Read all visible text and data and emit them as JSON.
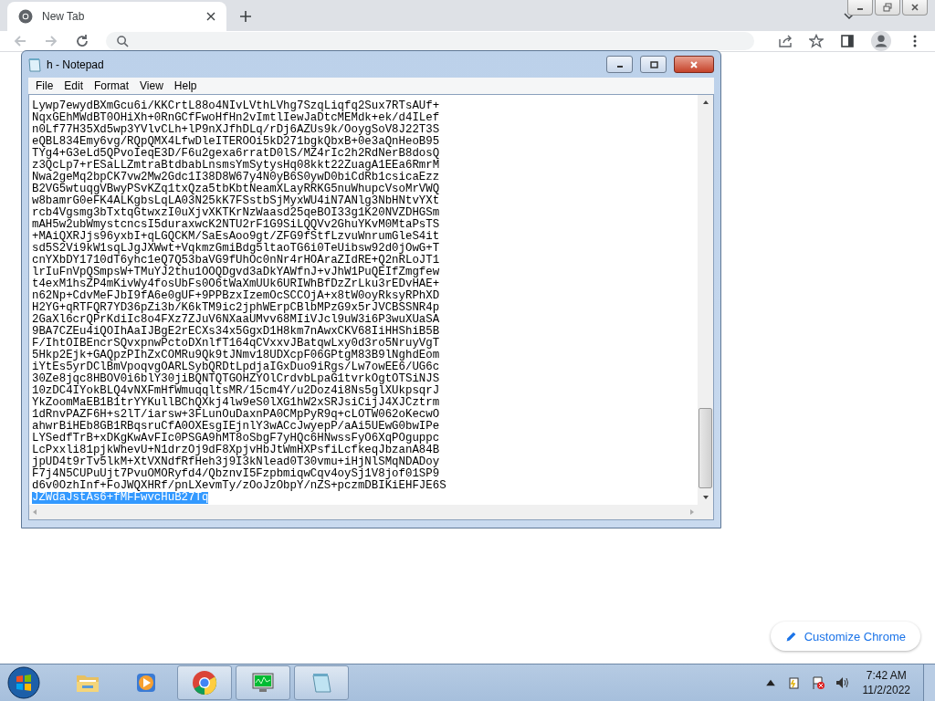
{
  "browser": {
    "tabs": [
      {
        "title": "New Tab",
        "selected": true
      }
    ],
    "customize_button": "Customize Chrome"
  },
  "notepad": {
    "title": "h - Notepad",
    "menu": [
      "File",
      "Edit",
      "Format",
      "View",
      "Help"
    ],
    "lines": [
      {
        "text": "Lywp7ewydBXmGcu6i/KKCrtL88o4NIvLVthLVhg7SzqLiqfq2Sux7RTsAUf+",
        "selected": false
      },
      {
        "text": "NqxGEhMWdBT0OHiXh+0RnGCfFwoHfHn2vImtlIewJaDtcMEMdk+ek/d4ILef",
        "selected": false
      },
      {
        "text": "n0Lf77H35Xd5wp3YVlvCLh+lP9nXJfhDLq/rDj6AZUs9k/OoygSoV8J22T3S",
        "selected": false
      },
      {
        "text": "eQBL834Emy6vg/RQpQMX4LfwDleITEROOi5kD271bgkQbxB+0e3aQnHeoB95",
        "selected": false
      },
      {
        "text": "TYg4+G3eLd5QPvoIeqE3D/F6u2gexa6rratD0lS/MZ4rIc2h2RdNerB8dosQ",
        "selected": false
      },
      {
        "text": "z3QcLp7+rESaLLZmtraBtdbabLnsmsYmSytysHq08kkt22ZuagA1EEa6RmrM",
        "selected": false
      },
      {
        "text": "Nwa2geMq2bpCK7vw2Mw2Gdc1I38D8W67y4N0yB6S0ywD0biCdRb1csicaEzz",
        "selected": false
      },
      {
        "text": "B2VG5wtuqgVBwyPSvKZq1txQza5tbKbtNeamXLayRRKG5nuWhupcVsoMrVWQ",
        "selected": false
      },
      {
        "text": "w8bamrG0eFK4ALKgbsLqLA03N25kK7FSstbSjMyxWU4iN7ANlg3NbHNtvYXt",
        "selected": false
      },
      {
        "text": "rcb4Vgsmg3bTxtqGtwxzI0uXjvXKTKrNzWaasd25qeBOI33g1K20NVZDHGSm",
        "selected": false
      },
      {
        "text": "mAH5w2ubWmystcncsI5duraxwcK2NTU2rF1G9SiLQQVv2GhuYKvM0MtaPsTS",
        "selected": false
      },
      {
        "text": "+MAiQXRJjs96yxbI+qLGQCKM/SaEsAoo9gt/ZFG9fStfLzvuWnrumGleS4it",
        "selected": false
      },
      {
        "text": "sd5S2Vi9kW1sqLJgJXWwt+VqkmzGmiBdg5ltaoTG6i0TeUibsw92d0jOwG+T",
        "selected": false
      },
      {
        "text": "cnYXbDY1710dT6yhc1eQ7Q53baVG9fUhOc0nNr4rHOAraZIdRE+Q2nRLoJT1",
        "selected": false
      },
      {
        "text": "lrIuFnVpQSmpsW+TMuYJ2thu1OOQDgvd3aDkYAWfnJ+vJhW1PuQEIfZmgfew",
        "selected": false
      },
      {
        "text": "t4exM1hsZP4mKivWy4fosUbFs0O6tWaXmUUk6URIWhBfDzZrLku3rEDvHAE+",
        "selected": false
      },
      {
        "text": "n62Np+CdvMeFJbI9fA6e0gUF+9PPBzxIzemOcSCCOjA+x8tW0oyRksyRPhXD",
        "selected": false
      },
      {
        "text": "H2YG+qRTFQR7YD36pZi3b/K6kTM9ic2jphWErpCBlbMPzG9x5rJVCBSSNR4p",
        "selected": false
      },
      {
        "text": "2GaXl6crQPrKdiIc8o4FXz7ZJuV6NXaaUMvv68MIiVJcl9uW3i6P3wuXUaSA",
        "selected": false
      },
      {
        "text": "9BA7CZEu4iQOIhAaIJBgE2rECXs34x5GgxD1H8km7nAwxCKV68IiHHShiB5B",
        "selected": false
      },
      {
        "text": "F/IhtOIBEncrSQvxpnwPctoDXnlfT164qCVxxvJBatqwLxy0d3ro5NruyVgT",
        "selected": false
      },
      {
        "text": "5Hkp2Ejk+GAQpzPIhZxCOMRu9Qk9tJNmv18UDXcpF06GPtgM83B9lNghdEom",
        "selected": false
      },
      {
        "text": "iYtEs5yrDClBmVpoqvgOARLSybQRDtLpdjaIGxDuo9iRgs/Lw7owEE6/UG6c",
        "selected": false
      },
      {
        "text": "30Ze8jqc8HBOV0i6blY30jiBQNTQTGOHZYOlCrdvbLpaG1tvrkOgtOTSiNJS",
        "selected": false
      },
      {
        "text": "10zDC4IYokBLQ4vNXFmHfWmuqqltsMR/15cm4Y/u2Doz4i8Ns5glXUkpsqrJ",
        "selected": false
      },
      {
        "text": "YkZoomMaEB1B1trYYKullBChQXkj4lw9eS0lXG1hW2xSRJsiCijJ4XJCztrm",
        "selected": false
      },
      {
        "text": "1dRnvPAZF6H+s2lT/iarsw+3FLunOuDaxnPA0CMpPyR9q+cLOTW062oKecwO",
        "selected": false
      },
      {
        "text": "ahwrBiHEb8GB1RBqsruCfA0OXEsgIEjnlY3wACcJwyepP/aAi5UEwG0bwIPe",
        "selected": false
      },
      {
        "text": "LYSedfTrB+xDKgKwAvFIc0PSGA9hMT8oSbgF7yHQc6HNwssFyO6XqPOguppc",
        "selected": false
      },
      {
        "text": "LcPxxli81pjkWhevU+N1drzOj9dF8XpjvHbJtWmHXPsfiLcfkeqJbzanA84B",
        "selected": false
      },
      {
        "text": "jpUD4t9rTv5lkM+XtVXNdfRfHeh3j9I3kNlead0T30vmu+iHjNlSMqNDADoy",
        "selected": false
      },
      {
        "text": "F7j4N5CUPuUjt7PvuOMORyfd4/QbznvI5FzpbmiqwCqv4oySj1V8jof01SP9",
        "selected": false
      },
      {
        "text": "d6v0OzhInf+FoJWQXHRf/pnLXevmTy/zOoJzObpY/nZS+pczmDBIKiEHFJE6S",
        "selected": false
      },
      {
        "text": "JZWdaJstAs6+fMFFwvcHuB27Tq",
        "selected": true
      }
    ]
  },
  "taskbar": {
    "apps": [
      {
        "kind": "folder",
        "open": false
      },
      {
        "kind": "media",
        "open": false
      },
      {
        "kind": "chrome",
        "open": true
      },
      {
        "kind": "monitor",
        "open": true
      },
      {
        "kind": "notepad",
        "open": true
      }
    ],
    "time": "7:42 AM",
    "date": "11/2/2022"
  }
}
